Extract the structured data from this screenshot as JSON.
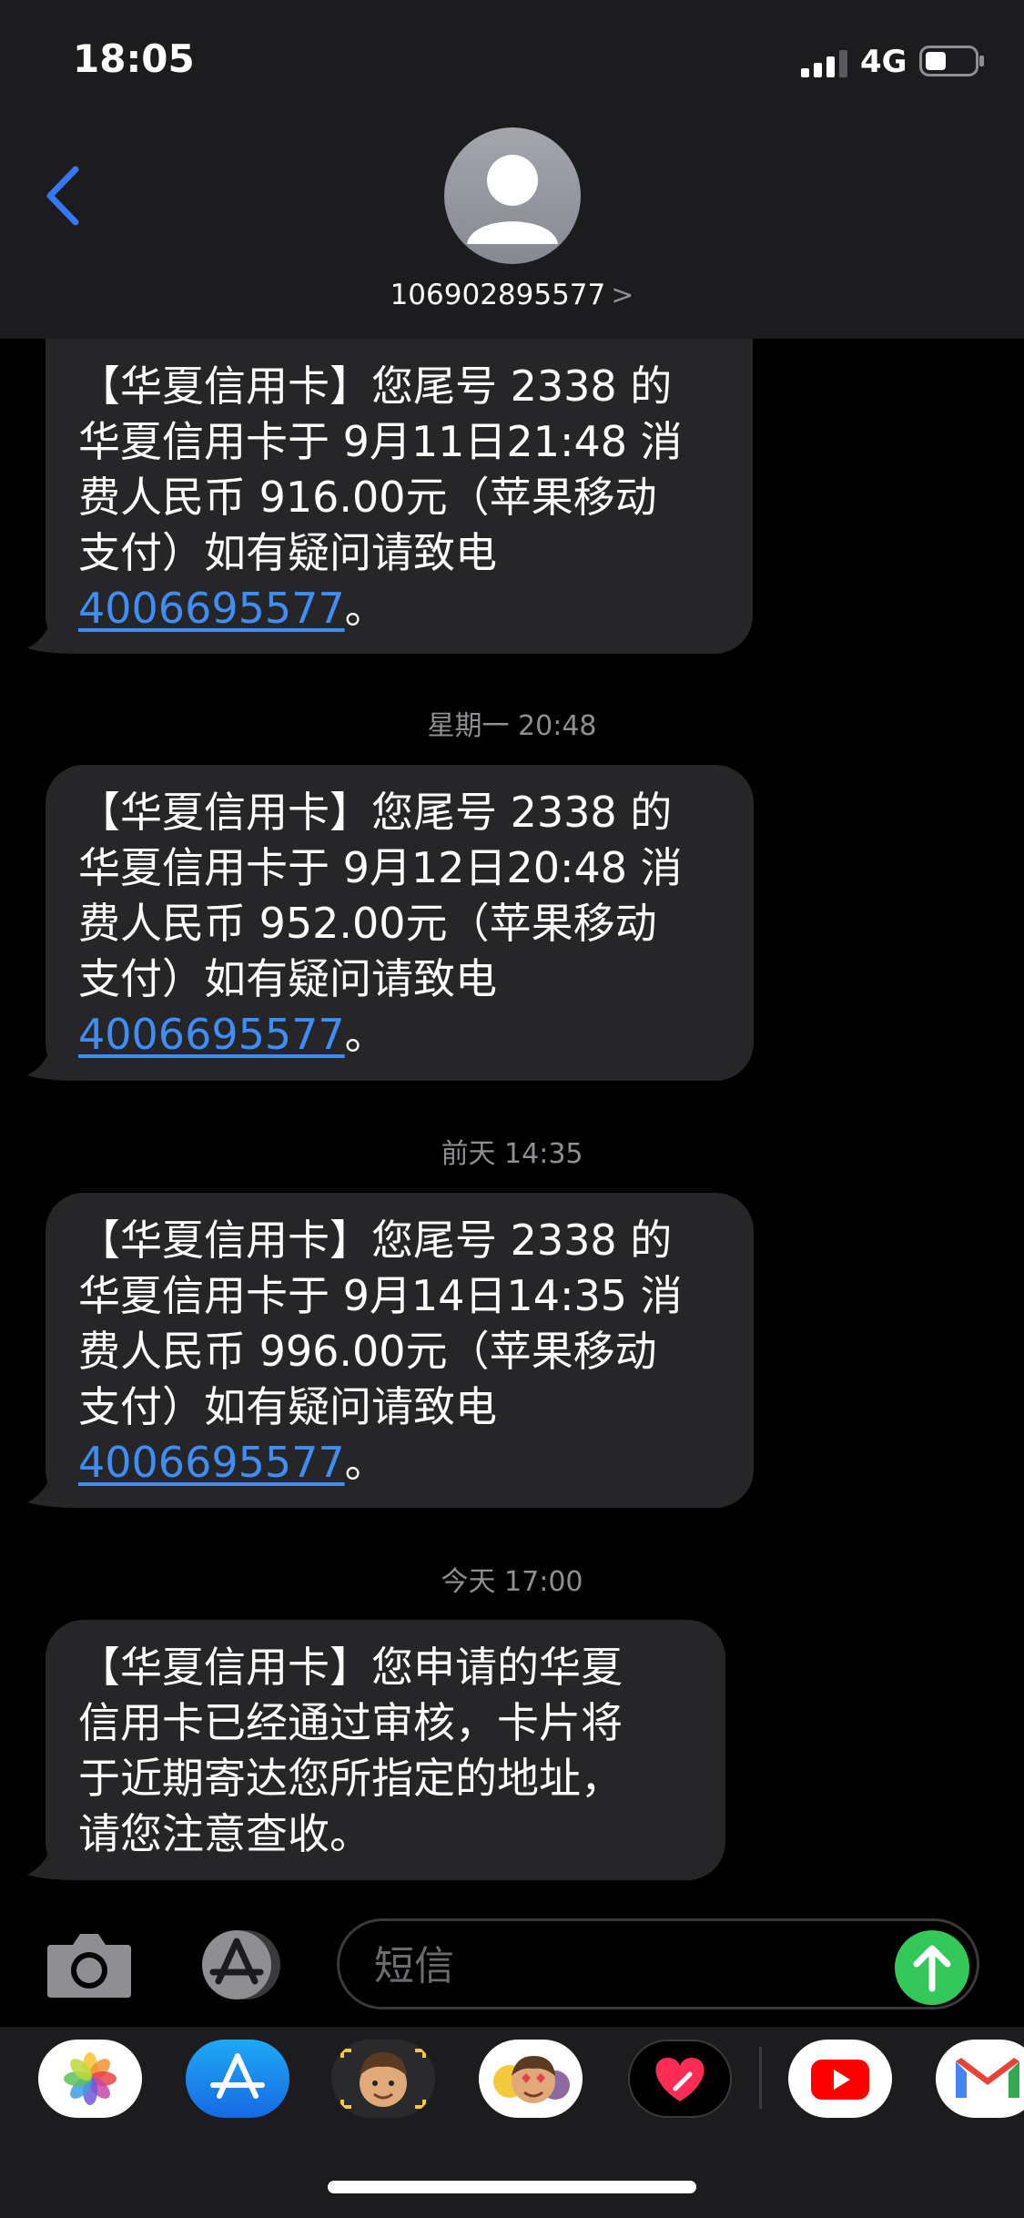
{
  "status_bar": {
    "time": "18:05",
    "network": "4G"
  },
  "header": {
    "contact": "106902895577"
  },
  "messages": [
    {
      "text": "【华夏信用卡】您尾号 2338 的\n华夏信用卡于 9月11日21:48 消\n费人民币 916.00元（苹果移动\n支付）如有疑问请致电\n",
      "link": "4006695577",
      "end": "。"
    },
    {
      "timestamp": "星期一 20:48",
      "text": "【华夏信用卡】您尾号 2338 的\n华夏信用卡于 9月12日20:48 消\n费人民币 952.00元（苹果移动\n支付）如有疑问请致电\n",
      "link": "4006695577",
      "end": "。"
    },
    {
      "timestamp": "前天 14:35",
      "text": "【华夏信用卡】您尾号 2338 的\n华夏信用卡于 9月14日14:35 消\n费人民币 996.00元（苹果移动\n支付）如有疑问请致电\n",
      "link": "4006695577",
      "end": "。"
    },
    {
      "timestamp": "今天 17:00",
      "text": "【华夏信用卡】您申请的华夏\n信用卡已经通过审核，卡片将\n于近期寄达您所指定的地址，\n请您注意查收。"
    }
  ],
  "compose": {
    "placeholder": "短信"
  },
  "apps": [
    "photos-icon",
    "app-store-icon",
    "memoji-icon",
    "animoji-icon",
    "digital-touch-icon",
    "youtube-icon",
    "gmail-icon"
  ],
  "colors": {
    "bubble": "#262628",
    "link": "#3f8df7",
    "send": "#34c759",
    "back": "#3478f6"
  }
}
